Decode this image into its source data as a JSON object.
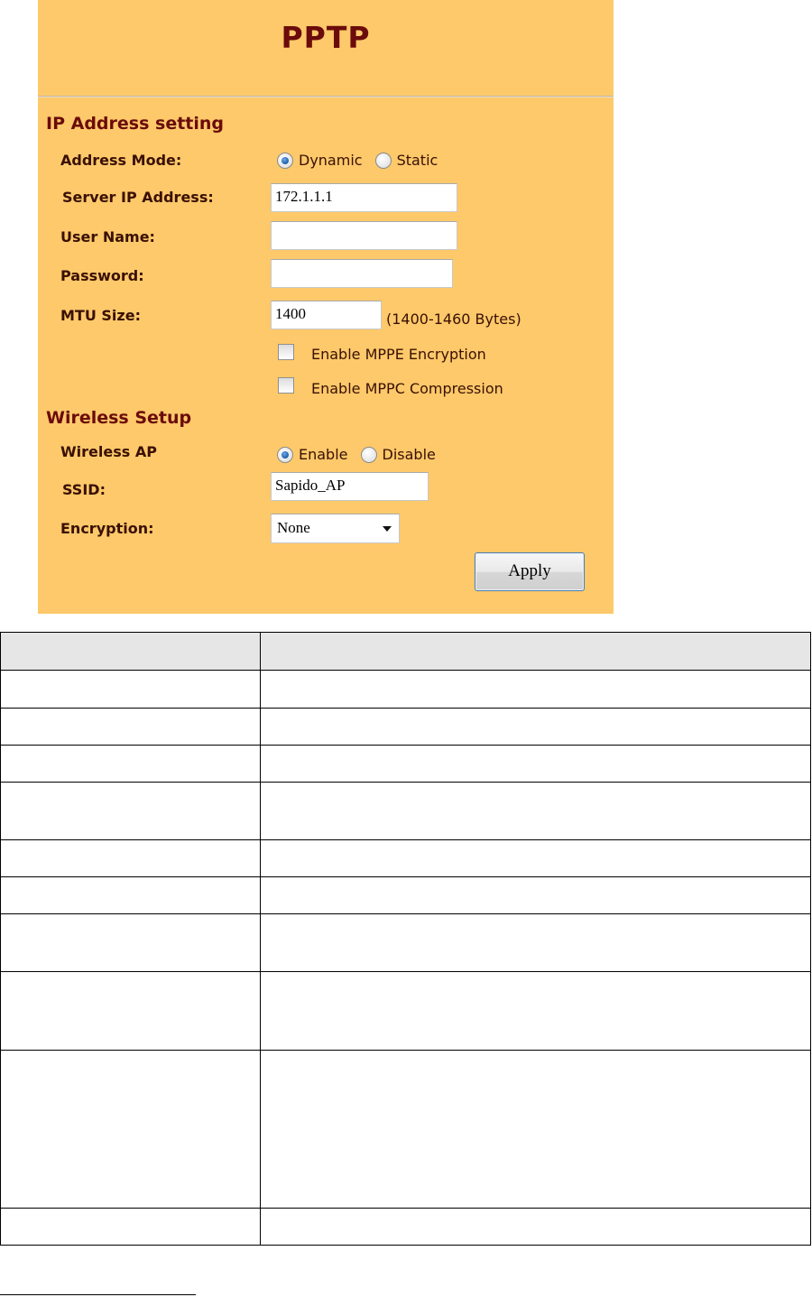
{
  "panel": {
    "title": "PPTP",
    "colors": {
      "background": "#fdc96a",
      "heading": "#6b0b0b",
      "label": "#3a1005"
    }
  },
  "ip_section": {
    "heading": "IP Address setting",
    "address_mode": {
      "label": "Address Mode:",
      "options": [
        "Dynamic",
        "Static"
      ],
      "selected": "Dynamic"
    },
    "server_ip": {
      "label": "Server IP Address:",
      "value": "172.1.1.1"
    },
    "user_name": {
      "label": "User Name:",
      "value": ""
    },
    "password": {
      "label": "Password:",
      "value": ""
    },
    "mtu": {
      "label": "MTU Size:",
      "value": "1400",
      "hint": "(1400-1460 Bytes)"
    },
    "mppe": {
      "label": "Enable MPPE Encryption",
      "checked": false
    },
    "mppc": {
      "label": "Enable MPPC Compression",
      "checked": false
    }
  },
  "wireless_section": {
    "heading": "Wireless Setup",
    "wireless_ap": {
      "label": "Wireless AP",
      "options": [
        "Enable",
        "Disable"
      ],
      "selected": "Enable"
    },
    "ssid": {
      "label": "SSID:",
      "value": "Sapido_AP"
    },
    "encryption": {
      "label": "Encryption:",
      "value": "None"
    }
  },
  "apply_label": "Apply",
  "table": {
    "headers": [
      "",
      ""
    ],
    "rows": [
      [
        "",
        ""
      ],
      [
        "",
        ""
      ],
      [
        "",
        ""
      ],
      [
        "",
        ""
      ],
      [
        "",
        ""
      ],
      [
        "",
        ""
      ],
      [
        "",
        ""
      ],
      [
        "",
        ""
      ],
      [
        "",
        ""
      ],
      [
        "",
        ""
      ]
    ]
  }
}
